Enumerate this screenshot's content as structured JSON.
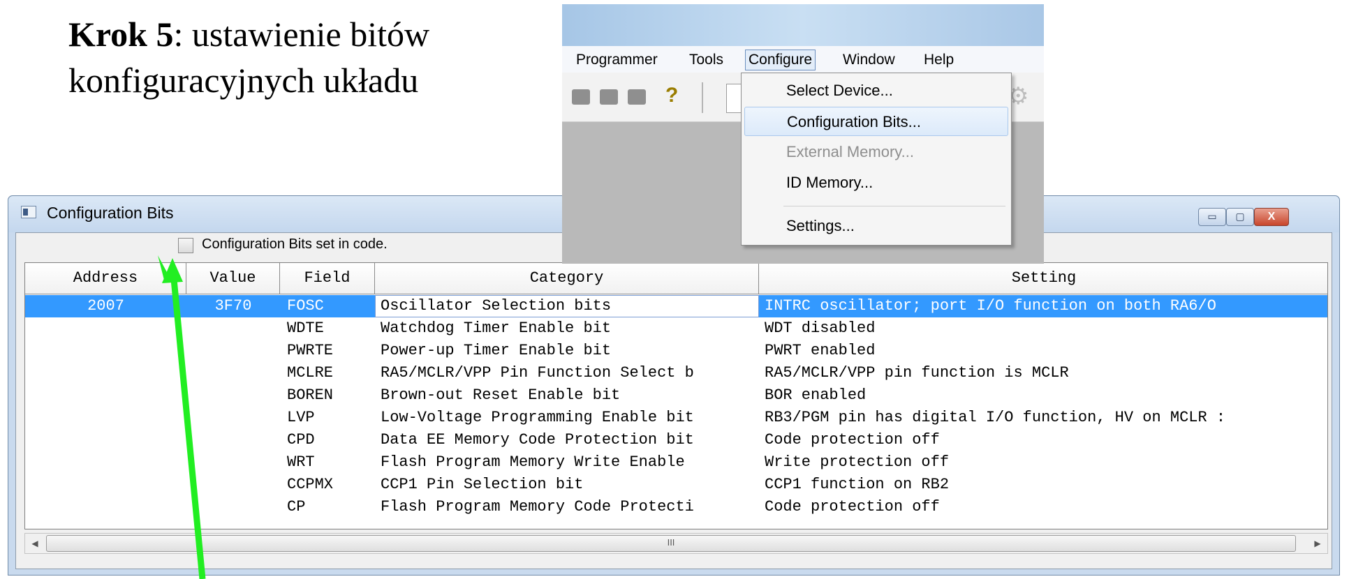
{
  "heading": {
    "bold": "Krok 5",
    "rest": ": ustawienie bitów",
    "line2": "konfiguracyjnych układu"
  },
  "window": {
    "title": "Configuration Bits",
    "controls": {
      "minimize": "▭",
      "maximize": "▢",
      "close": "X"
    },
    "checkbox_label": "Configuration Bits set in code.",
    "checkbox_checked": false
  },
  "grid": {
    "headers": [
      "Address",
      "Value",
      "Field",
      "Category",
      "Setting"
    ],
    "rows": [
      {
        "address": "2007",
        "value": "3F70",
        "field": "FOSC",
        "category": "Oscillator Selection bits",
        "setting": "INTRC oscillator; port I/O function on both RA6/O"
      },
      {
        "address": "",
        "value": "",
        "field": "WDTE",
        "category": "Watchdog Timer Enable bit",
        "setting": "WDT disabled"
      },
      {
        "address": "",
        "value": "",
        "field": "PWRTE",
        "category": "Power-up Timer Enable bit",
        "setting": "PWRT enabled"
      },
      {
        "address": "",
        "value": "",
        "field": "MCLRE",
        "category": "RA5/MCLR/VPP Pin Function Select b",
        "setting": "RA5/MCLR/VPP pin function is MCLR"
      },
      {
        "address": "",
        "value": "",
        "field": "BOREN",
        "category": "Brown-out Reset Enable bit",
        "setting": "BOR enabled"
      },
      {
        "address": "",
        "value": "",
        "field": "LVP",
        "category": "Low-Voltage Programming Enable bit",
        "setting": "RB3/PGM pin has digital I/O function, HV on MCLR :"
      },
      {
        "address": "",
        "value": "",
        "field": "CPD",
        "category": "Data EE Memory Code Protection bit",
        "setting": "Code protection off"
      },
      {
        "address": "",
        "value": "",
        "field": "WRT",
        "category": "Flash Program Memory Write Enable",
        "setting": "Write protection off"
      },
      {
        "address": "",
        "value": "",
        "field": "CCPMX",
        "category": "CCP1 Pin Selection bit",
        "setting": "CCP1 function on RB2"
      },
      {
        "address": "",
        "value": "",
        "field": "CP",
        "category": "Flash Program Memory Code Protecti",
        "setting": "Code protection off"
      }
    ],
    "scroll_thumb": "III",
    "selected_row": 0
  },
  "inset": {
    "menubar": [
      "Programmer",
      "Tools",
      "Configure",
      "Window",
      "Help"
    ],
    "active_menu": "Configure",
    "dropdown": [
      {
        "label": "Select Device...",
        "state": "normal"
      },
      {
        "label": "Configuration Bits...",
        "state": "hover"
      },
      {
        "label": "External Memory...",
        "state": "disabled"
      },
      {
        "label": "ID Memory...",
        "state": "normal"
      },
      {
        "label": "Settings...",
        "state": "normal"
      }
    ],
    "toolbar_help": "?"
  },
  "colors": {
    "selection": "#3399ff",
    "arrow": "#22ee22",
    "title_bar": "#c4d7ee"
  }
}
